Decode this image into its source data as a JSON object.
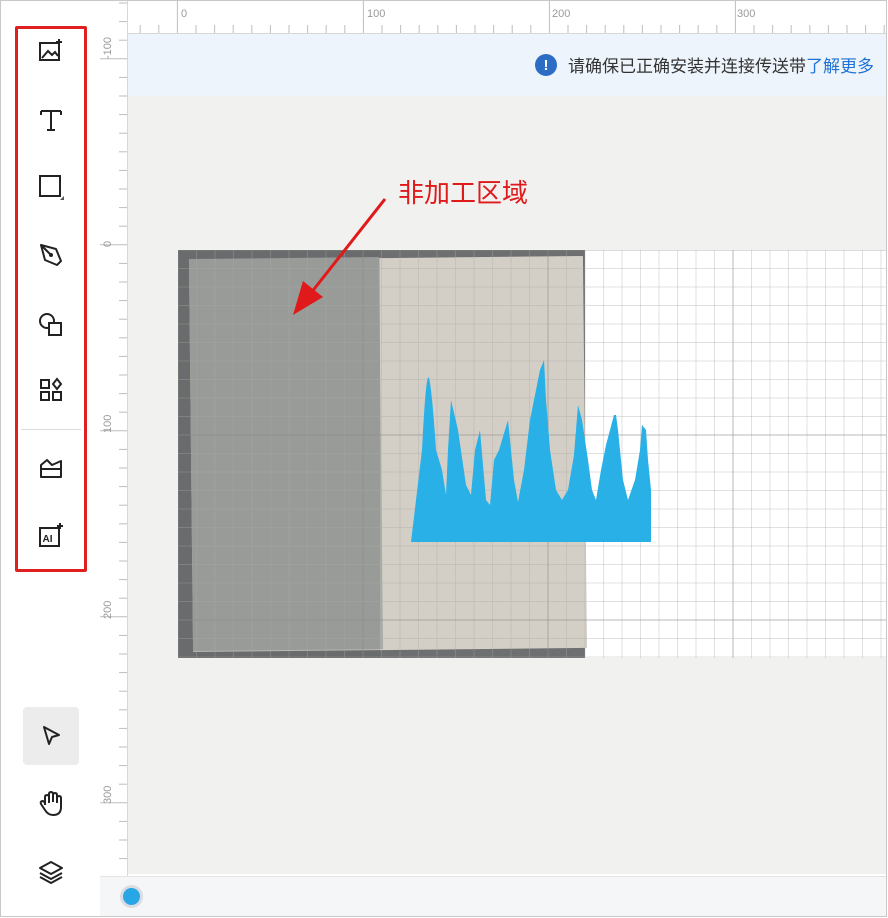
{
  "notice": {
    "text": "请确保已正确安装并连接传送带",
    "link": "了解更多"
  },
  "annotation": {
    "label": "非加工区域"
  },
  "ruler": {
    "top_labels": [
      "0",
      "100",
      "200",
      "300"
    ],
    "left_labels": [
      "-100",
      "0",
      "100",
      "200",
      "300"
    ]
  },
  "toolbar": {
    "tools": [
      "add-image",
      "text",
      "shape",
      "pen",
      "shapes-library",
      "elements",
      "materials",
      "ai-generate"
    ],
    "bottom_tools": [
      "select",
      "hand",
      "layers"
    ]
  },
  "colors": {
    "highlight": "#e02020",
    "annotation": "#e01a1a",
    "shape_fill": "#29b0e6",
    "link": "#1f73d6",
    "notice_icon": "#2d6cc4"
  }
}
